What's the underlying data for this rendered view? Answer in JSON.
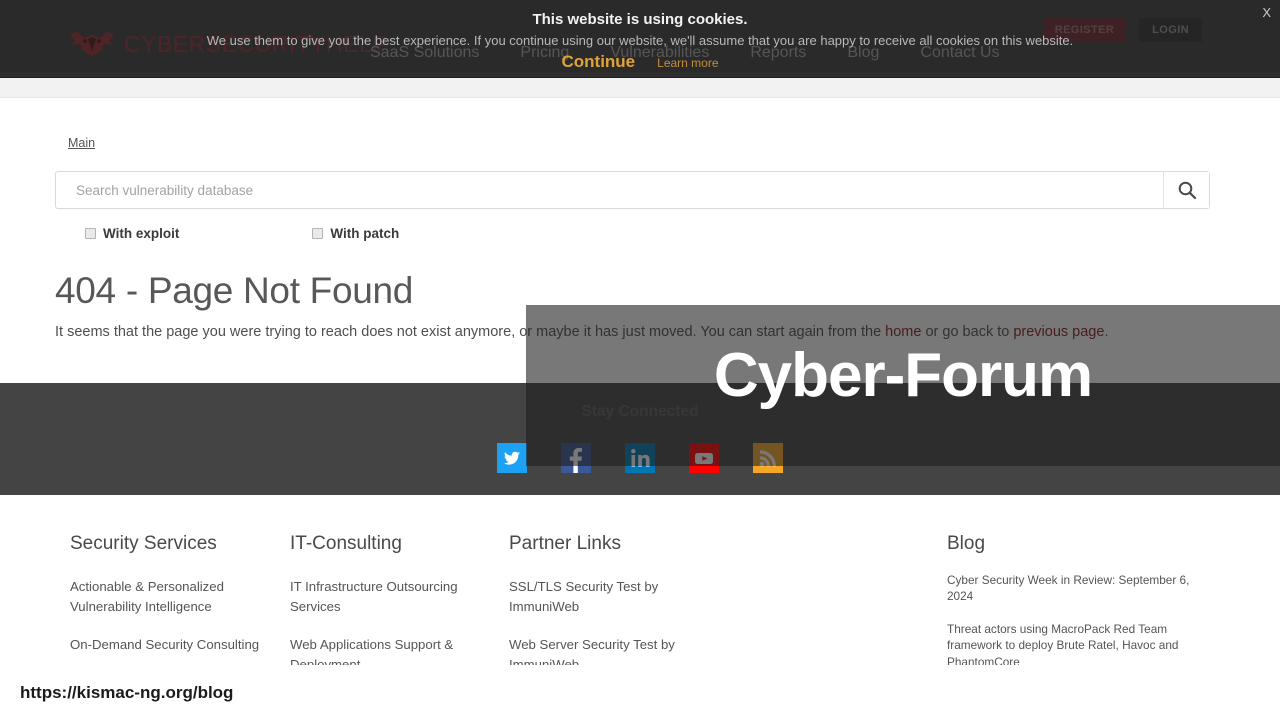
{
  "header": {
    "logo_text_main": "CYBERSECURITY",
    "logo_text_accent": "HELP",
    "logo_icon": "bat-mask-logo-icon",
    "nav": [
      {
        "label": "SaaS Solutions"
      },
      {
        "label": "Pricing"
      },
      {
        "label": "Vulnerabilities"
      },
      {
        "label": "Reports"
      },
      {
        "label": "Blog"
      },
      {
        "label": "Contact Us"
      }
    ],
    "register_label": "REGISTER",
    "login_label": "LOGIN"
  },
  "cookie_banner": {
    "title": "This website is using cookies.",
    "text": "We use them to give you the best experience. If you continue using our website, we'll assume that you are happy to receive all cookies on this website.",
    "continue_label": "Continue",
    "learn_more_label": "Learn more",
    "close_label": "X",
    "accent_color": "#e0a33a"
  },
  "breadcrumb": {
    "label": "Main"
  },
  "search": {
    "placeholder": "Search vulnerability database",
    "value": "",
    "button_icon": "search-icon"
  },
  "filters": [
    {
      "label": "With exploit",
      "checked": false
    },
    {
      "label": "With patch",
      "checked": false
    }
  ],
  "error": {
    "title": "404 - Page Not Found",
    "text_before": "It seems that the page you were trying to reach does not exist anymore, or maybe it has just moved. You can start again from the ",
    "link_home": "home",
    "text_middle": " or go back to ",
    "link_previous": "previous page",
    "text_after": ".",
    "link_color": "#8b1d25"
  },
  "social": {
    "heading": "Stay Connected",
    "items": [
      {
        "name": "twitter-icon",
        "color": "#1da1f2"
      },
      {
        "name": "facebook-icon",
        "color": "#3b5998"
      },
      {
        "name": "linkedin-icon",
        "color": "#0077b5"
      },
      {
        "name": "youtube-icon",
        "color": "#ff0000"
      },
      {
        "name": "rss-icon",
        "color": "#f5a623"
      }
    ]
  },
  "footer_columns": [
    {
      "title": "Security Services",
      "links": [
        "Actionable & Personalized Vulnerability Intelligence",
        "On-Demand Security Consulting"
      ]
    },
    {
      "title": "IT-Consulting",
      "links": [
        "IT Infrastructure Outsourcing Services",
        "Web Applications Support & Deployment"
      ]
    },
    {
      "title": "Partner Links",
      "links": [
        "SSL/TLS Security Test by ImmuniWeb",
        "Web Server Security Test by ImmuniWeb"
      ]
    },
    {
      "title": "Blog",
      "links": [
        "Cyber Security Week in Review: September 6, 2024",
        "Threat actors using MacroPack Red Team framework to deploy Brute Ratel, Havoc and PhantomCore"
      ]
    }
  ],
  "overlay": {
    "title": "Cyber-Forum"
  },
  "url_bar": {
    "url": "https://kismac-ng.org/blog"
  }
}
